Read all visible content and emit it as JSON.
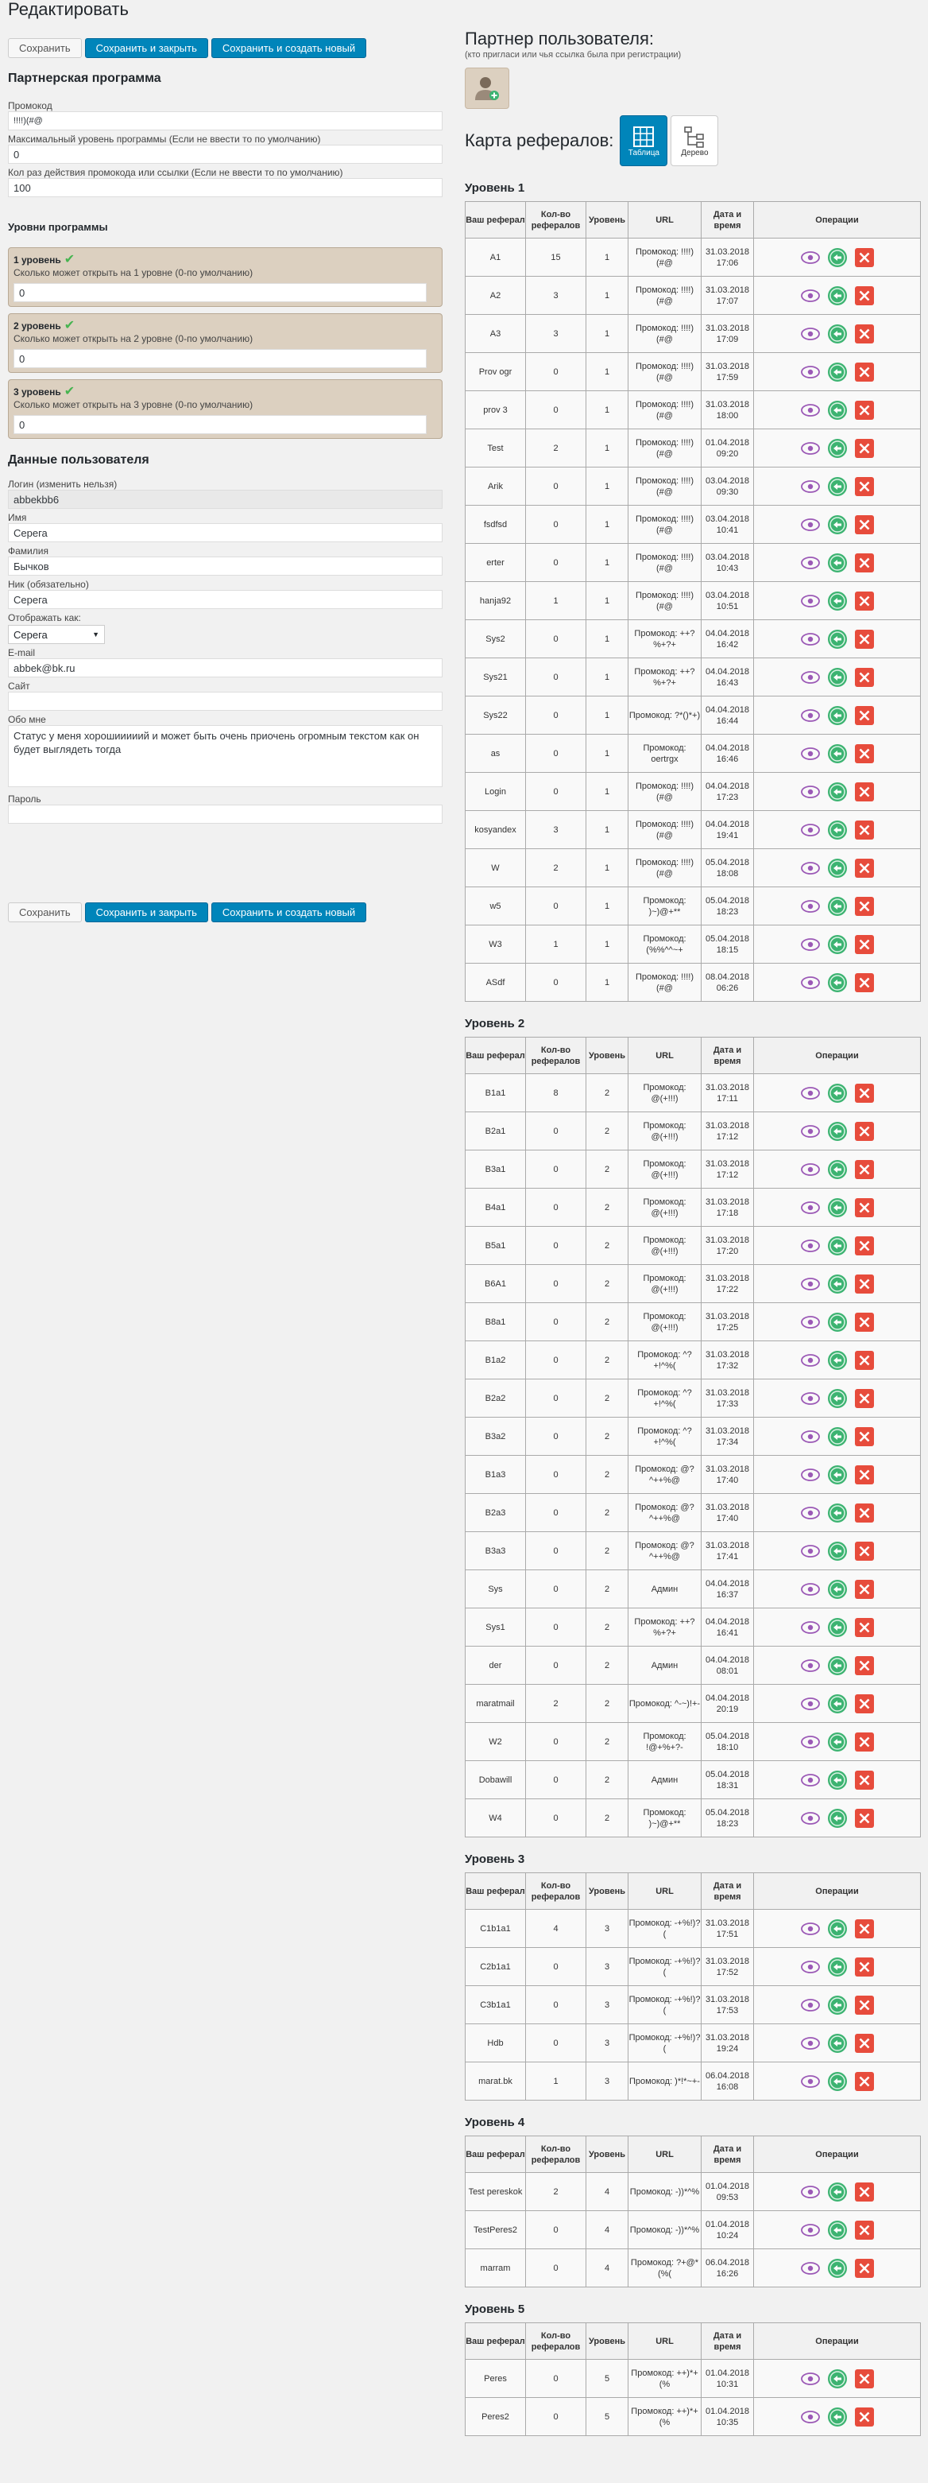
{
  "page": {
    "title": "Редактировать"
  },
  "toolbar": {
    "save": "Сохранить",
    "save_close": "Сохранить и закрыть",
    "save_new": "Сохранить и создать новый"
  },
  "program": {
    "title": "Партнерская программа",
    "promo_label": "Промокод",
    "promo_value": "!!!!)(#@",
    "maxlevel_label": "Максимальный уровень программы (Если не ввести то по умолчанию)",
    "maxlevel_value": "0",
    "uses_label": "Кол раз действия промокода или ссылки (Если не ввести то по умолчанию)",
    "uses_value": "100",
    "levels_title": "Уровни программы",
    "levels": [
      {
        "title": "1 уровень",
        "hint": "Сколько может открыть на 1 уровне (0-по умолчанию)",
        "value": "0"
      },
      {
        "title": "2 уровень",
        "hint": "Сколько может открыть на 2 уровне (0-по умолчанию)",
        "value": "0"
      },
      {
        "title": "3 уровень",
        "hint": "Сколько может открыть на 3 уровне (0-по умолчанию)",
        "value": "0"
      }
    ]
  },
  "user": {
    "title": "Данные пользователя",
    "login_label": "Логин (изменить нельзя)",
    "login_value": "abbekbb6",
    "name_label": "Имя",
    "name_value": "Серега",
    "surname_label": "Фамилия",
    "surname_value": "Бычков",
    "nick_label": "Ник (обязательно)",
    "nick_value": "Серега",
    "display_label": "Отображать как:",
    "display_value": "Серега",
    "email_label": "E-mail",
    "email_value": "abbek@bk.ru",
    "site_label": "Сайт",
    "site_value": "",
    "about_label": "Обо мне",
    "about_value": "Статус у меня хорошииииий и может быть очень приочень огромным текстом как он будет выглядеть тогда",
    "password_label": "Пароль",
    "password_value": ""
  },
  "partner": {
    "title": "Партнер пользователя:",
    "subtitle": "(кто пригласи или чья ссылка была при регистрации)"
  },
  "refmap": {
    "title": "Карта рефералов:",
    "view_table": "Таблица",
    "view_tree": "Дерево"
  },
  "table_headers": [
    "Ваш реферал",
    "Кол-во рефералов",
    "Уровень",
    "URL",
    "Дата и время",
    "Операции"
  ],
  "levels": [
    {
      "title": "Уровень 1",
      "rows": [
        [
          "A1",
          "15",
          "1",
          "Промокод: !!!!)(#@",
          "31.03.2018 17:06"
        ],
        [
          "A2",
          "3",
          "1",
          "Промокод: !!!!)(#@",
          "31.03.2018 17:07"
        ],
        [
          "A3",
          "3",
          "1",
          "Промокод: !!!!)(#@",
          "31.03.2018 17:09"
        ],
        [
          "Prov ogr",
          "0",
          "1",
          "Промокод: !!!!)(#@",
          "31.03.2018 17:59"
        ],
        [
          "prov 3",
          "0",
          "1",
          "Промокод: !!!!)(#@",
          "31.03.2018 18:00"
        ],
        [
          "Test",
          "2",
          "1",
          "Промокод: !!!!)(#@",
          "01.04.2018 09:20"
        ],
        [
          "Arik",
          "0",
          "1",
          "Промокод: !!!!)(#@",
          "03.04.2018 09:30"
        ],
        [
          "fsdfsd",
          "0",
          "1",
          "Промокод: !!!!)(#@",
          "03.04.2018 10:41"
        ],
        [
          "erter",
          "0",
          "1",
          "Промокод: !!!!)(#@",
          "03.04.2018 10:43"
        ],
        [
          "hanja92",
          "1",
          "1",
          "Промокод: !!!!)(#@",
          "03.04.2018 10:51"
        ],
        [
          "Sys2",
          "0",
          "1",
          "Промокод: ++?%+?+",
          "04.04.2018 16:42"
        ],
        [
          "Sys21",
          "0",
          "1",
          "Промокод: ++?%+?+",
          "04.04.2018 16:43"
        ],
        [
          "Sys22",
          "0",
          "1",
          "Промокод: ?*()*+)",
          "04.04.2018 16:44"
        ],
        [
          "as",
          "0",
          "1",
          "Промокод: oertrgx",
          "04.04.2018 16:46"
        ],
        [
          "Login",
          "0",
          "1",
          "Промокод: !!!!)(#@",
          "04.04.2018 17:23"
        ],
        [
          "kosyandex",
          "3",
          "1",
          "Промокод: !!!!)(#@",
          "04.04.2018 19:41"
        ],
        [
          "W",
          "2",
          "1",
          "Промокод: !!!!)(#@",
          "05.04.2018 18:08"
        ],
        [
          "w5",
          "0",
          "1",
          "Промокод: )~)@+**",
          "05.04.2018 18:23"
        ],
        [
          "W3",
          "1",
          "1",
          "Промокод: (%%^^~+",
          "05.04.2018 18:15"
        ],
        [
          "ASdf",
          "0",
          "1",
          "Промокод: !!!!)(#@",
          "08.04.2018 06:26"
        ]
      ]
    },
    {
      "title": "Уровень 2",
      "rows": [
        [
          "B1a1",
          "8",
          "2",
          "Промокод: @(+!!!)",
          "31.03.2018 17:11"
        ],
        [
          "B2a1",
          "0",
          "2",
          "Промокод: @(+!!!)",
          "31.03.2018 17:12"
        ],
        [
          "B3a1",
          "0",
          "2",
          "Промокод: @(+!!!)",
          "31.03.2018 17:12"
        ],
        [
          "B4a1",
          "0",
          "2",
          "Промокод: @(+!!!)",
          "31.03.2018 17:18"
        ],
        [
          "B5a1",
          "0",
          "2",
          "Промокод: @(+!!!)",
          "31.03.2018 17:20"
        ],
        [
          "B6A1",
          "0",
          "2",
          "Промокод: @(+!!!)",
          "31.03.2018 17:22"
        ],
        [
          "B8a1",
          "0",
          "2",
          "Промокод: @(+!!!)",
          "31.03.2018 17:25"
        ],
        [
          "B1a2",
          "0",
          "2",
          "Промокод: ^?+!^%(",
          "31.03.2018 17:32"
        ],
        [
          "B2a2",
          "0",
          "2",
          "Промокод: ^?+!^%(",
          "31.03.2018 17:33"
        ],
        [
          "B3a2",
          "0",
          "2",
          "Промокод: ^?+!^%(",
          "31.03.2018 17:34"
        ],
        [
          "B1a3",
          "0",
          "2",
          "Промокод: @?^++%@",
          "31.03.2018 17:40"
        ],
        [
          "B2a3",
          "0",
          "2",
          "Промокод: @?^++%@",
          "31.03.2018 17:40"
        ],
        [
          "B3a3",
          "0",
          "2",
          "Промокод: @?^++%@",
          "31.03.2018 17:41"
        ],
        [
          "Sys",
          "0",
          "2",
          "Админ",
          "04.04.2018 16:37"
        ],
        [
          "Sys1",
          "0",
          "2",
          "Промокод: ++?%+?+",
          "04.04.2018 16:41"
        ],
        [
          "der",
          "0",
          "2",
          "Админ",
          "04.04.2018 08:01"
        ],
        [
          "maratmail",
          "2",
          "2",
          "Промокод: ^-~)!+-",
          "04.04.2018 20:19"
        ],
        [
          "W2",
          "0",
          "2",
          "Промокод: !@+%+?-",
          "05.04.2018 18:10"
        ],
        [
          "Dobawill",
          "0",
          "2",
          "Админ",
          "05.04.2018 18:31"
        ],
        [
          "W4",
          "0",
          "2",
          "Промокод: )~)@+**",
          "05.04.2018 18:23"
        ]
      ]
    },
    {
      "title": "Уровень 3",
      "rows": [
        [
          "C1b1a1",
          "4",
          "3",
          "Промокод: -+%!)?(",
          "31.03.2018 17:51"
        ],
        [
          "C2b1a1",
          "0",
          "3",
          "Промокод: -+%!)?(",
          "31.03.2018 17:52"
        ],
        [
          "C3b1a1",
          "0",
          "3",
          "Промокод: -+%!)?(",
          "31.03.2018 17:53"
        ],
        [
          "Hdb",
          "0",
          "3",
          "Промокод: -+%!)?(",
          "31.03.2018 19:24"
        ],
        [
          "marat.bk",
          "1",
          "3",
          "Промокод: )*!*~+-",
          "06.04.2018 16:08"
        ]
      ]
    },
    {
      "title": "Уровень 4",
      "rows": [
        [
          "Test pereskok",
          "2",
          "4",
          "Промокод: -))*^%",
          "01.04.2018 09:53"
        ],
        [
          "TestPeres2",
          "0",
          "4",
          "Промокод: -))*^%",
          "01.04.2018 10:24"
        ],
        [
          "marram",
          "0",
          "4",
          "Промокод: ?+@*(%(",
          "06.04.2018 16:26"
        ]
      ]
    },
    {
      "title": "Уровень 5",
      "rows": [
        [
          "Peres",
          "0",
          "5",
          "Промокод: ++)*+(%",
          "01.04.2018 10:31"
        ],
        [
          "Peres2",
          "0",
          "5",
          "Промокод: ++)*+(%",
          "01.04.2018 10:35"
        ]
      ]
    }
  ],
  "colors": {
    "primary": "#0085ba",
    "view_icon": "#9b59b6",
    "restore_icon": "#3cb371",
    "delete_icon": "#e74c3c",
    "level_box": "#dcd0c0"
  }
}
